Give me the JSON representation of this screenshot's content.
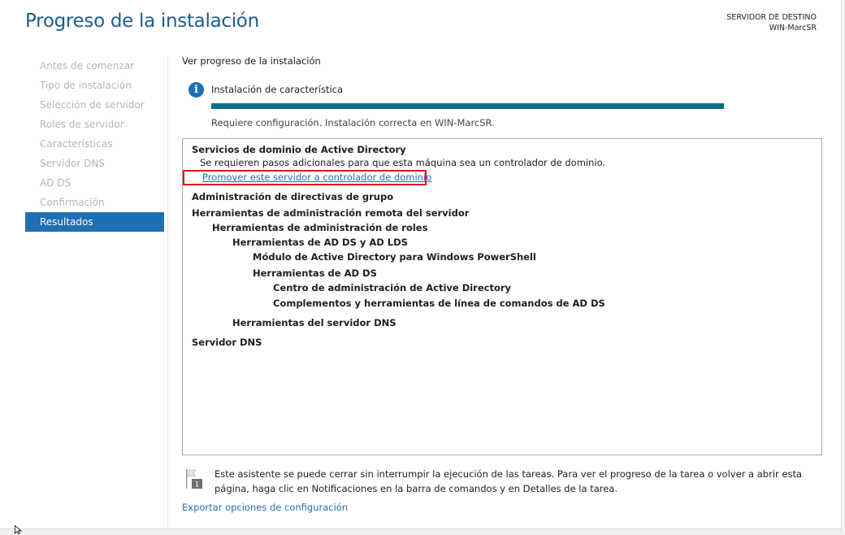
{
  "page": {
    "title": "Progreso de la instalación",
    "destination_label": "SERVIDOR DE DESTINO",
    "destination_server": "WIN-MarcSR"
  },
  "nav": {
    "items": [
      {
        "label": "Antes de comenzar"
      },
      {
        "label": "Tipo de instalación"
      },
      {
        "label": "Selección de servidor"
      },
      {
        "label": "Roles de servidor"
      },
      {
        "label": "Características"
      },
      {
        "label": "Servidor DNS"
      },
      {
        "label": "AD DS"
      },
      {
        "label": "Confirmación"
      },
      {
        "label": "Resultados"
      }
    ],
    "active_index": 8
  },
  "main": {
    "section_title": "Ver progreso de la instalación",
    "status_title": "Instalación de característica",
    "progress_fraction": 1.0,
    "status_message": "Requiere configuración. Instalación correcta en WIN-MarcSR.",
    "results": {
      "ad_ds_title": "Servicios de dominio de Active Directory",
      "ad_ds_note": "Se requieren pasos adicionales para que esta máquina sea un controlador de dominio.",
      "promote_link": "Promover este servidor a controlador de dominio",
      "tree": [
        "Administración de directivas de grupo",
        "Herramientas de administración remota del servidor",
        "Herramientas de administración de roles",
        "Herramientas de AD DS y AD LDS",
        "Módulo de Active Directory para Windows PowerShell",
        "Herramientas de AD DS",
        "Centro de administración de Active Directory",
        "Complementos y herramientas de línea de comandos de AD DS",
        "Herramientas del servidor DNS",
        "Servidor DNS"
      ]
    },
    "note": "Este asistente se puede cerrar sin interrumpir la ejecución de las tareas. Para ver el progreso de la tarea o volver a abrir esta página, haga clic en Notificaciones en la barra de comandos y en Detalles de la tarea.",
    "notification_badge": "1",
    "export_link": "Exportar opciones de configuración"
  },
  "colors": {
    "accent": "#1f6fb5",
    "title": "#1c5e8a",
    "progress": "#0f6f8c",
    "highlight_box": "#e8141a"
  },
  "icons": {
    "status": "info-icon",
    "notification": "flag-icon"
  }
}
